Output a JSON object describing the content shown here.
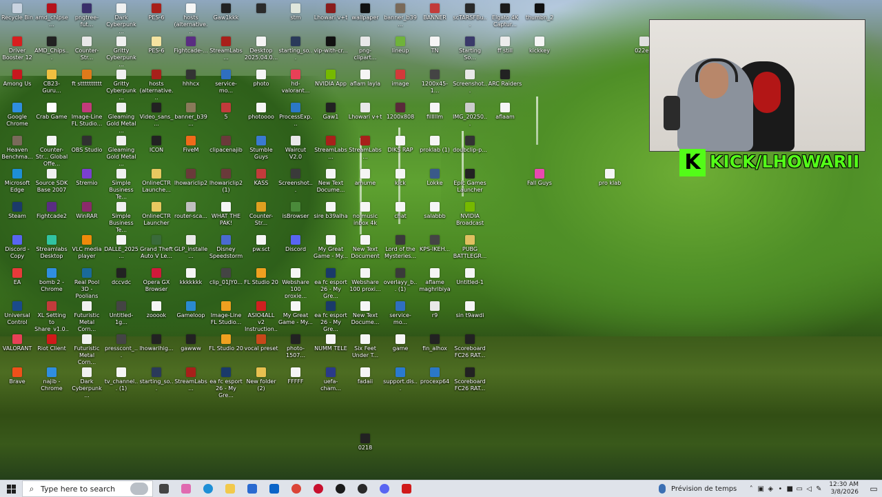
{
  "desktop": {
    "icons": [
      {
        "label": "Recycle Bin",
        "color": "#c9d3e0"
      },
      {
        "label": "amd_chipse...",
        "color": "#b5121b"
      },
      {
        "label": "pngtree-fut...",
        "color": "#3a2f6b"
      },
      {
        "label": "Dark Cyberpunk ...",
        "color": "#f0f0f0"
      },
      {
        "label": "PES-6",
        "color": "#a8201a"
      },
      {
        "label": "hosts (alternative...",
        "color": "#f5f5f5"
      },
      {
        "label": "Gaw1kkk",
        "color": "#222222"
      },
      {
        "label": "",
        "color": "#2b2b2b"
      },
      {
        "label": "stm",
        "color": "#dfe6dc"
      },
      {
        "label": "Lhowari v+t",
        "color": "#8a1c1c"
      },
      {
        "label": "wallpaper",
        "color": "#111111"
      },
      {
        "label": "banner_b39...",
        "color": "#7a6a5a"
      },
      {
        "label": "BANNER",
        "color": "#c23b3b"
      },
      {
        "label": "scTARSFBu...",
        "color": "#2a2a2a"
      },
      {
        "label": "Elgato 4K Captur...",
        "color": "#1b1b1b"
      },
      {
        "label": "thumbn_2",
        "color": "#111111"
      },
      {
        "label": "Driver Booster 12",
        "color": "#d81e1e"
      },
      {
        "label": "AMD_Chips...",
        "color": "#222222"
      },
      {
        "label": "Counter-Str...",
        "color": "#e8e8e8"
      },
      {
        "label": "Gritty Cyberpunk ...",
        "color": "#f0f0f0"
      },
      {
        "label": "PES-6",
        "color": "#f4e3a0"
      },
      {
        "label": "Fightcade-...",
        "color": "#5a2d82"
      },
      {
        "label": "StreamLabs...",
        "color": "#a8201a"
      },
      {
        "label": "Desktop 2025.04.0...",
        "color": "#f5f5f5"
      },
      {
        "label": "starting_so...",
        "color": "#2a3a5a"
      },
      {
        "label": "vip-with-cr...",
        "color": "#111111"
      },
      {
        "label": "png-clipart...",
        "color": "#e8e8e8"
      },
      {
        "label": "lineup",
        "color": "#6fb33a"
      },
      {
        "label": "TN",
        "color": "#f5f5f5"
      },
      {
        "label": "Starting So...",
        "color": "#3a3a6a"
      },
      {
        "label": "ff still",
        "color": "#ececec"
      },
      {
        "label": "kickkey",
        "color": "#f5f5f5"
      },
      {
        "label": "022e...",
        "color": "#e0e0e0"
      },
      {
        "label": "Among Us",
        "color": "#c8171e"
      },
      {
        "label": "CB23-Guru...",
        "color": "#f0c040"
      },
      {
        "label": "ft stttttttttt",
        "color": "#e07a1a"
      },
      {
        "label": "Gritty Cyberpunk ...",
        "color": "#f0f0f0"
      },
      {
        "label": "hosts (alternative...",
        "color": "#a8201a"
      },
      {
        "label": "hhhcx",
        "color": "#333333"
      },
      {
        "label": "service-mo...",
        "color": "#2f6fc0"
      },
      {
        "label": "photo",
        "color": "#f5f5f5"
      },
      {
        "label": "hd-valorant...",
        "color": "#e84057"
      },
      {
        "label": "NVIDIA App",
        "color": "#76b900"
      },
      {
        "label": "aflam layla",
        "color": "#f5f5f5"
      },
      {
        "label": "image",
        "color": "#d23a3a"
      },
      {
        "label": "1200x45-1...",
        "color": "#444444"
      },
      {
        "label": "Screenshot...",
        "color": "#e8e8e8"
      },
      {
        "label": "ARC Raiders",
        "color": "#222222"
      },
      {
        "label": "Google Chrome",
        "color": "#2f8ee0"
      },
      {
        "label": "Crab Game",
        "color": "#ffffff"
      },
      {
        "label": "Image-Line FL Studio...",
        "color": "#c23b7a"
      },
      {
        "label": "Gleaming Gold Metal ...",
        "color": "#f0f0f0"
      },
      {
        "label": "Video_sans_...",
        "color": "#222222"
      },
      {
        "label": "banner_b39...",
        "color": "#8a7a5a"
      },
      {
        "label": "5",
        "color": "#c23b3b"
      },
      {
        "label": "photoooo",
        "color": "#f5f5f5"
      },
      {
        "label": "ProcessExp...",
        "color": "#2b78c6"
      },
      {
        "label": "Gaw1",
        "color": "#222222"
      },
      {
        "label": "Lhowari v+t",
        "color": "#e8e8e8"
      },
      {
        "label": "1200x808",
        "color": "#5a2a3a"
      },
      {
        "label": "filllllm",
        "color": "#f5f5f5"
      },
      {
        "label": "IMG_20250...",
        "color": "#cccccc"
      },
      {
        "label": "aflaam",
        "color": "#f5f5f5"
      },
      {
        "label": "Heaven Benchma...",
        "color": "#7a6a5a"
      },
      {
        "label": "Counter-Str... Global Offe...",
        "color": "#f5f5f5"
      },
      {
        "label": "OBS Studio",
        "color": "#303030"
      },
      {
        "label": "Gleaming Gold Metal ...",
        "color": "#f0f0f0"
      },
      {
        "label": "ICON",
        "color": "#222222"
      },
      {
        "label": "FiveM",
        "color": "#f06a1a"
      },
      {
        "label": "clipacenajib",
        "color": "#6a3a3a"
      },
      {
        "label": "Stumble Guys",
        "color": "#3a7ad0"
      },
      {
        "label": "Waircut V2.0",
        "color": "#e8e8e8"
      },
      {
        "label": "StreamLabs...",
        "color": "#a8201a"
      },
      {
        "label": "StreamLabs...",
        "color": "#a8201a"
      },
      {
        "label": "DIKS RAP",
        "color": "#f5f5f5"
      },
      {
        "label": "proklab (1)",
        "color": "#f5f5f5"
      },
      {
        "label": "doubclip-p...",
        "color": "#333333"
      },
      {
        "label": "Microsoft Edge",
        "color": "#1e8fd6"
      },
      {
        "label": "Source SDK Base 2007",
        "color": "#f0f0f0"
      },
      {
        "label": "Stremio",
        "color": "#7b3fd0"
      },
      {
        "label": "Simple Business Te...",
        "color": "#f0f0f0"
      },
      {
        "label": "OnlineCTR Launche...",
        "color": "#e8c860"
      },
      {
        "label": "lhowariclip2",
        "color": "#6a3a3a"
      },
      {
        "label": "lhowariclip2 (1)",
        "color": "#6a3a3a"
      },
      {
        "label": "KASS",
        "color": "#c23b3b"
      },
      {
        "label": "Screenshot...",
        "color": "#3a3a3a"
      },
      {
        "label": "New Text Docume...",
        "color": "#f5f5f5"
      },
      {
        "label": "amume",
        "color": "#f5f5f5"
      },
      {
        "label": "kick",
        "color": "#f5f5f5"
      },
      {
        "label": "Lokke",
        "color": "#3a5a8a"
      },
      {
        "label": "Epic Games Launcher",
        "color": "#222222"
      },
      {
        "label": "Fall Guys",
        "color": "#e84ab0"
      },
      {
        "label": "pro klab",
        "color": "#f5f5f5"
      },
      {
        "label": "Steam",
        "color": "#1b3a6a"
      },
      {
        "label": "Fightcade2",
        "color": "#5a2d82"
      },
      {
        "label": "WinRAR",
        "color": "#8a2a6a"
      },
      {
        "label": "Simple Business Te...",
        "color": "#f0f0f0"
      },
      {
        "label": "OnlineCTR Launcher",
        "color": "#e8c860"
      },
      {
        "label": "router-sca...",
        "color": "#c0c0c0"
      },
      {
        "label": "WHAT THE PAK!",
        "color": "#f5f5f5"
      },
      {
        "label": "Counter-Str...",
        "color": "#e0a020"
      },
      {
        "label": "isBrowser",
        "color": "#4a8a3a"
      },
      {
        "label": "sire b39alha",
        "color": "#f5f5f5"
      },
      {
        "label": "no music inbox 4k",
        "color": "#f5f5f5"
      },
      {
        "label": "chat",
        "color": "#f5f5f5"
      },
      {
        "label": "salabbb",
        "color": "#f5f5f5"
      },
      {
        "label": "NVIDIA Broadcast",
        "color": "#76b900"
      },
      {
        "label": "Discord - Copy",
        "color": "#5865f2"
      },
      {
        "label": "Streamlabs Desktop",
        "color": "#31c3a2"
      },
      {
        "label": "VLC media player",
        "color": "#f08a0a"
      },
      {
        "label": "DALLE_2025...",
        "color": "#f5f5f5"
      },
      {
        "label": "Grand Theft Auto V Le...",
        "color": "#3a6a3a"
      },
      {
        "label": "GLP_installe...",
        "color": "#e8e8e8"
      },
      {
        "label": "Disney Speedstorm",
        "color": "#4a6ad0"
      },
      {
        "label": "pw.sct",
        "color": "#f5f5f5"
      },
      {
        "label": "Discord",
        "color": "#5865f2"
      },
      {
        "label": "My Great Game - My...",
        "color": "#f5f5f5"
      },
      {
        "label": "New Text Document",
        "color": "#f5f5f5"
      },
      {
        "label": "Lord of the Mysteries...",
        "color": "#3a3a3a"
      },
      {
        "label": "KPS-IKEH...",
        "color": "#444444"
      },
      {
        "label": "PUBG BATTLEGR...",
        "color": "#e0c060"
      },
      {
        "label": "EA",
        "color": "#e83a3a"
      },
      {
        "label": "bomb 2 - Chrome",
        "color": "#2f8ee0"
      },
      {
        "label": "Real Pool 3D - Poolians",
        "color": "#1a6a9a"
      },
      {
        "label": "dccvdc",
        "color": "#222222"
      },
      {
        "label": "Opera GX Browser",
        "color": "#d01a3a"
      },
      {
        "label": "kkkkkkk",
        "color": "#f5f5f5"
      },
      {
        "label": "clip_01JY0...",
        "color": "#444444"
      },
      {
        "label": "FL Studio 20",
        "color": "#f0a020"
      },
      {
        "label": "Webshare 100 proxie...",
        "color": "#f5f5f5"
      },
      {
        "label": "ea fc esport 26 - My Gre...",
        "color": "#1a3a6a"
      },
      {
        "label": "Webshare 100 proxi...",
        "color": "#f5f5f5"
      },
      {
        "label": "overlayy_b... (1)",
        "color": "#3a3a3a"
      },
      {
        "label": "aflame maghribiya",
        "color": "#f5f5f5"
      },
      {
        "label": "Untitled-1",
        "color": "#f5f5f5"
      },
      {
        "label": "Universal Control",
        "color": "#1a4a8a"
      },
      {
        "label": "XL Setting to Share_v1.0...",
        "color": "#c23b3b"
      },
      {
        "label": "Futuristic Metal Corn...",
        "color": "#f0f0f0"
      },
      {
        "label": "Untitled-1g...",
        "color": "#444444"
      },
      {
        "label": "zooook",
        "color": "#f5f5f5"
      },
      {
        "label": "Gameloop",
        "color": "#2a8ad0"
      },
      {
        "label": "Image-Line FL Studio...",
        "color": "#f0a020"
      },
      {
        "label": "ASIO4ALL v2 Instruction...",
        "color": "#d02020"
      },
      {
        "label": "My Great Game - My...",
        "color": "#f5f5f5"
      },
      {
        "label": "ea fc esport 26 - My Gre...",
        "color": "#1a3a6a"
      },
      {
        "label": "New Text Docume...",
        "color": "#f5f5f5"
      },
      {
        "label": "service-mo...",
        "color": "#2f6fc0"
      },
      {
        "label": "r9",
        "color": "#e8e8e8"
      },
      {
        "label": "sin t9awdi",
        "color": "#f5f5f5"
      },
      {
        "label": "VALORANT",
        "color": "#e84057"
      },
      {
        "label": "Riot Client",
        "color": "#d01a1a"
      },
      {
        "label": "Futuristic Metal Corn...",
        "color": "#f0f0f0"
      },
      {
        "label": "presscont_...",
        "color": "#444444"
      },
      {
        "label": "lhowarihig...",
        "color": "#222222"
      },
      {
        "label": "gawww",
        "color": "#222222"
      },
      {
        "label": "FL Studio 20",
        "color": "#f0a020"
      },
      {
        "label": "vocal preset",
        "color": "#c8471a"
      },
      {
        "label": "photo-1507...",
        "color": "#222222"
      },
      {
        "label": "NUMM TELE",
        "color": "#f5f5f5"
      },
      {
        "label": "Six Feet Under T...",
        "color": "#f5f5f5"
      },
      {
        "label": "game",
        "color": "#f5f5f5"
      },
      {
        "label": "fin_alhox",
        "color": "#222222"
      },
      {
        "label": "Scoreboard FC26 RAT...",
        "color": "#222222"
      },
      {
        "label": "Brave",
        "color": "#f0501a"
      },
      {
        "label": "najib - Chrome",
        "color": "#2f8ee0"
      },
      {
        "label": "Dark Cyberpunk ...",
        "color": "#f0f0f0"
      },
      {
        "label": "tv_channel... (1)",
        "color": "#f5f5f5"
      },
      {
        "label": "starting_so...",
        "color": "#2a3a5a"
      },
      {
        "label": "StreamLabs...",
        "color": "#a8201a"
      },
      {
        "label": "ea fc esport 26 - My Gre...",
        "color": "#1a3a6a"
      },
      {
        "label": "New folder (2)",
        "color": "#e8c050"
      },
      {
        "label": "FFFFF",
        "color": "#f5f5f5"
      },
      {
        "label": "uefa-cham...",
        "color": "#2a3a8a"
      },
      {
        "label": "fadaii",
        "color": "#f5f5f5"
      },
      {
        "label": "support.dis...",
        "color": "#2a7ad0"
      },
      {
        "label": "procexp64",
        "color": "#2b78c6"
      },
      {
        "label": "Scoreboard FC26 RAT...",
        "color": "#222222"
      },
      {
        "label": "0218",
        "color": "#222222"
      }
    ]
  },
  "overlay": {
    "kick_logo": "K",
    "kick_text": "KICK/LHOWARII",
    "brand_color": "#53fc18"
  },
  "taskbar": {
    "search_placeholder": "Type here to search",
    "search_icon": "magnifier-icon",
    "pinned": [
      {
        "name": "task-view",
        "color": "#444444"
      },
      {
        "name": "copilot",
        "color": "#e06ab0"
      },
      {
        "name": "edge",
        "color": "#1e8fd6"
      },
      {
        "name": "file-explorer",
        "color": "#f2c94c"
      },
      {
        "name": "microsoft-store",
        "color": "#2a6ad0"
      },
      {
        "name": "outlook",
        "color": "#0a64c8"
      },
      {
        "name": "chrome",
        "color": "#db4437"
      },
      {
        "name": "app-red",
        "color": "#c8102e"
      },
      {
        "name": "elgato",
        "color": "#1b1b1b"
      },
      {
        "name": "app-dark",
        "color": "#2a2a2a"
      },
      {
        "name": "discord",
        "color": "#5865f2"
      },
      {
        "name": "app-red-square",
        "color": "#d01a1a"
      }
    ],
    "weather_label": "Prévision de temps",
    "tray_icons": [
      "chevron-up-icon",
      "monitor-icon",
      "shield-icon",
      "mic-icon",
      "camera-icon",
      "network-icon",
      "volume-icon",
      "pen-icon"
    ],
    "time": "12:30 AM",
    "date": "3/8/2026"
  }
}
